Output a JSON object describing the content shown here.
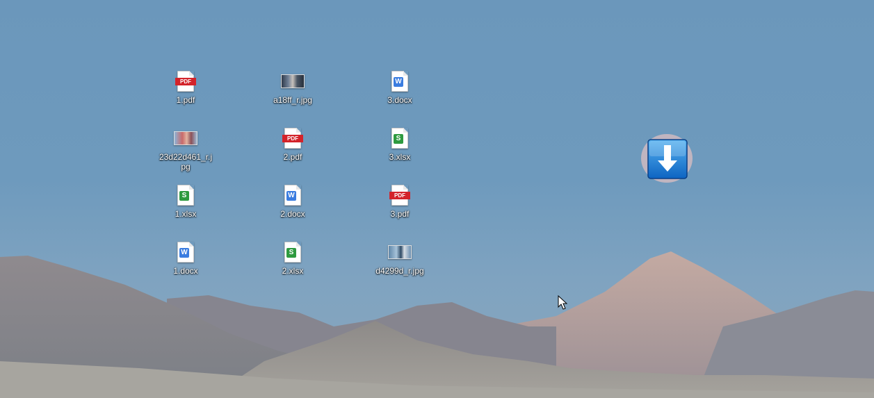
{
  "desktop": {
    "icons": [
      {
        "label": "1.pdf",
        "type": "pdf"
      },
      {
        "label": "a18ff_r.jpg",
        "type": "jpg"
      },
      {
        "label": "3.docx",
        "type": "docx"
      },
      {
        "label": "23d22d461_r.jpg",
        "type": "jpg"
      },
      {
        "label": "2.pdf",
        "type": "pdf"
      },
      {
        "label": "3.xlsx",
        "type": "xlsx"
      },
      {
        "label": "1.xlsx",
        "type": "xlsx"
      },
      {
        "label": "2.docx",
        "type": "docx"
      },
      {
        "label": "3.pdf",
        "type": "pdf"
      },
      {
        "label": "1.docx",
        "type": "docx"
      },
      {
        "label": "2.xlsx",
        "type": "xlsx"
      },
      {
        "label": "d4299d_r.jpg",
        "type": "jpg"
      }
    ],
    "pdf_band_text": "PDF",
    "word_badge": "W",
    "sheet_badge": "S"
  },
  "floating_widget": {
    "icon": "download-arrow-icon"
  },
  "colors": {
    "sky": "#6e9abd",
    "pdf": "#d3232a",
    "word": "#3b7de0",
    "sheet": "#2e9a3f",
    "widget": "#1c7fd6"
  }
}
